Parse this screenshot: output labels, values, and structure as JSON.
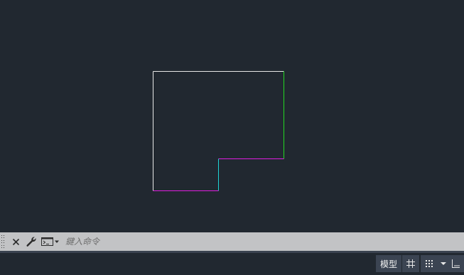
{
  "drawing": {
    "colors": {
      "background": "#212830",
      "white_edge": "#e8e8e8",
      "green_edge": "#22d922",
      "magenta_edge": "#e01ee0",
      "cyan_edge": "#1ed6d6"
    }
  },
  "command_line": {
    "close_icon": "close-icon",
    "settings_icon": "wrench-icon",
    "prompt_icon": "command-prompt-icon",
    "placeholder": "鍵入命令"
  },
  "status_bar": {
    "model_label": "模型",
    "grid_icon": "grid-icon",
    "snap_icon": "snap-dots-icon",
    "menu_icon": "chevron-down-icon",
    "ortho_icon": "ortho-icon"
  }
}
